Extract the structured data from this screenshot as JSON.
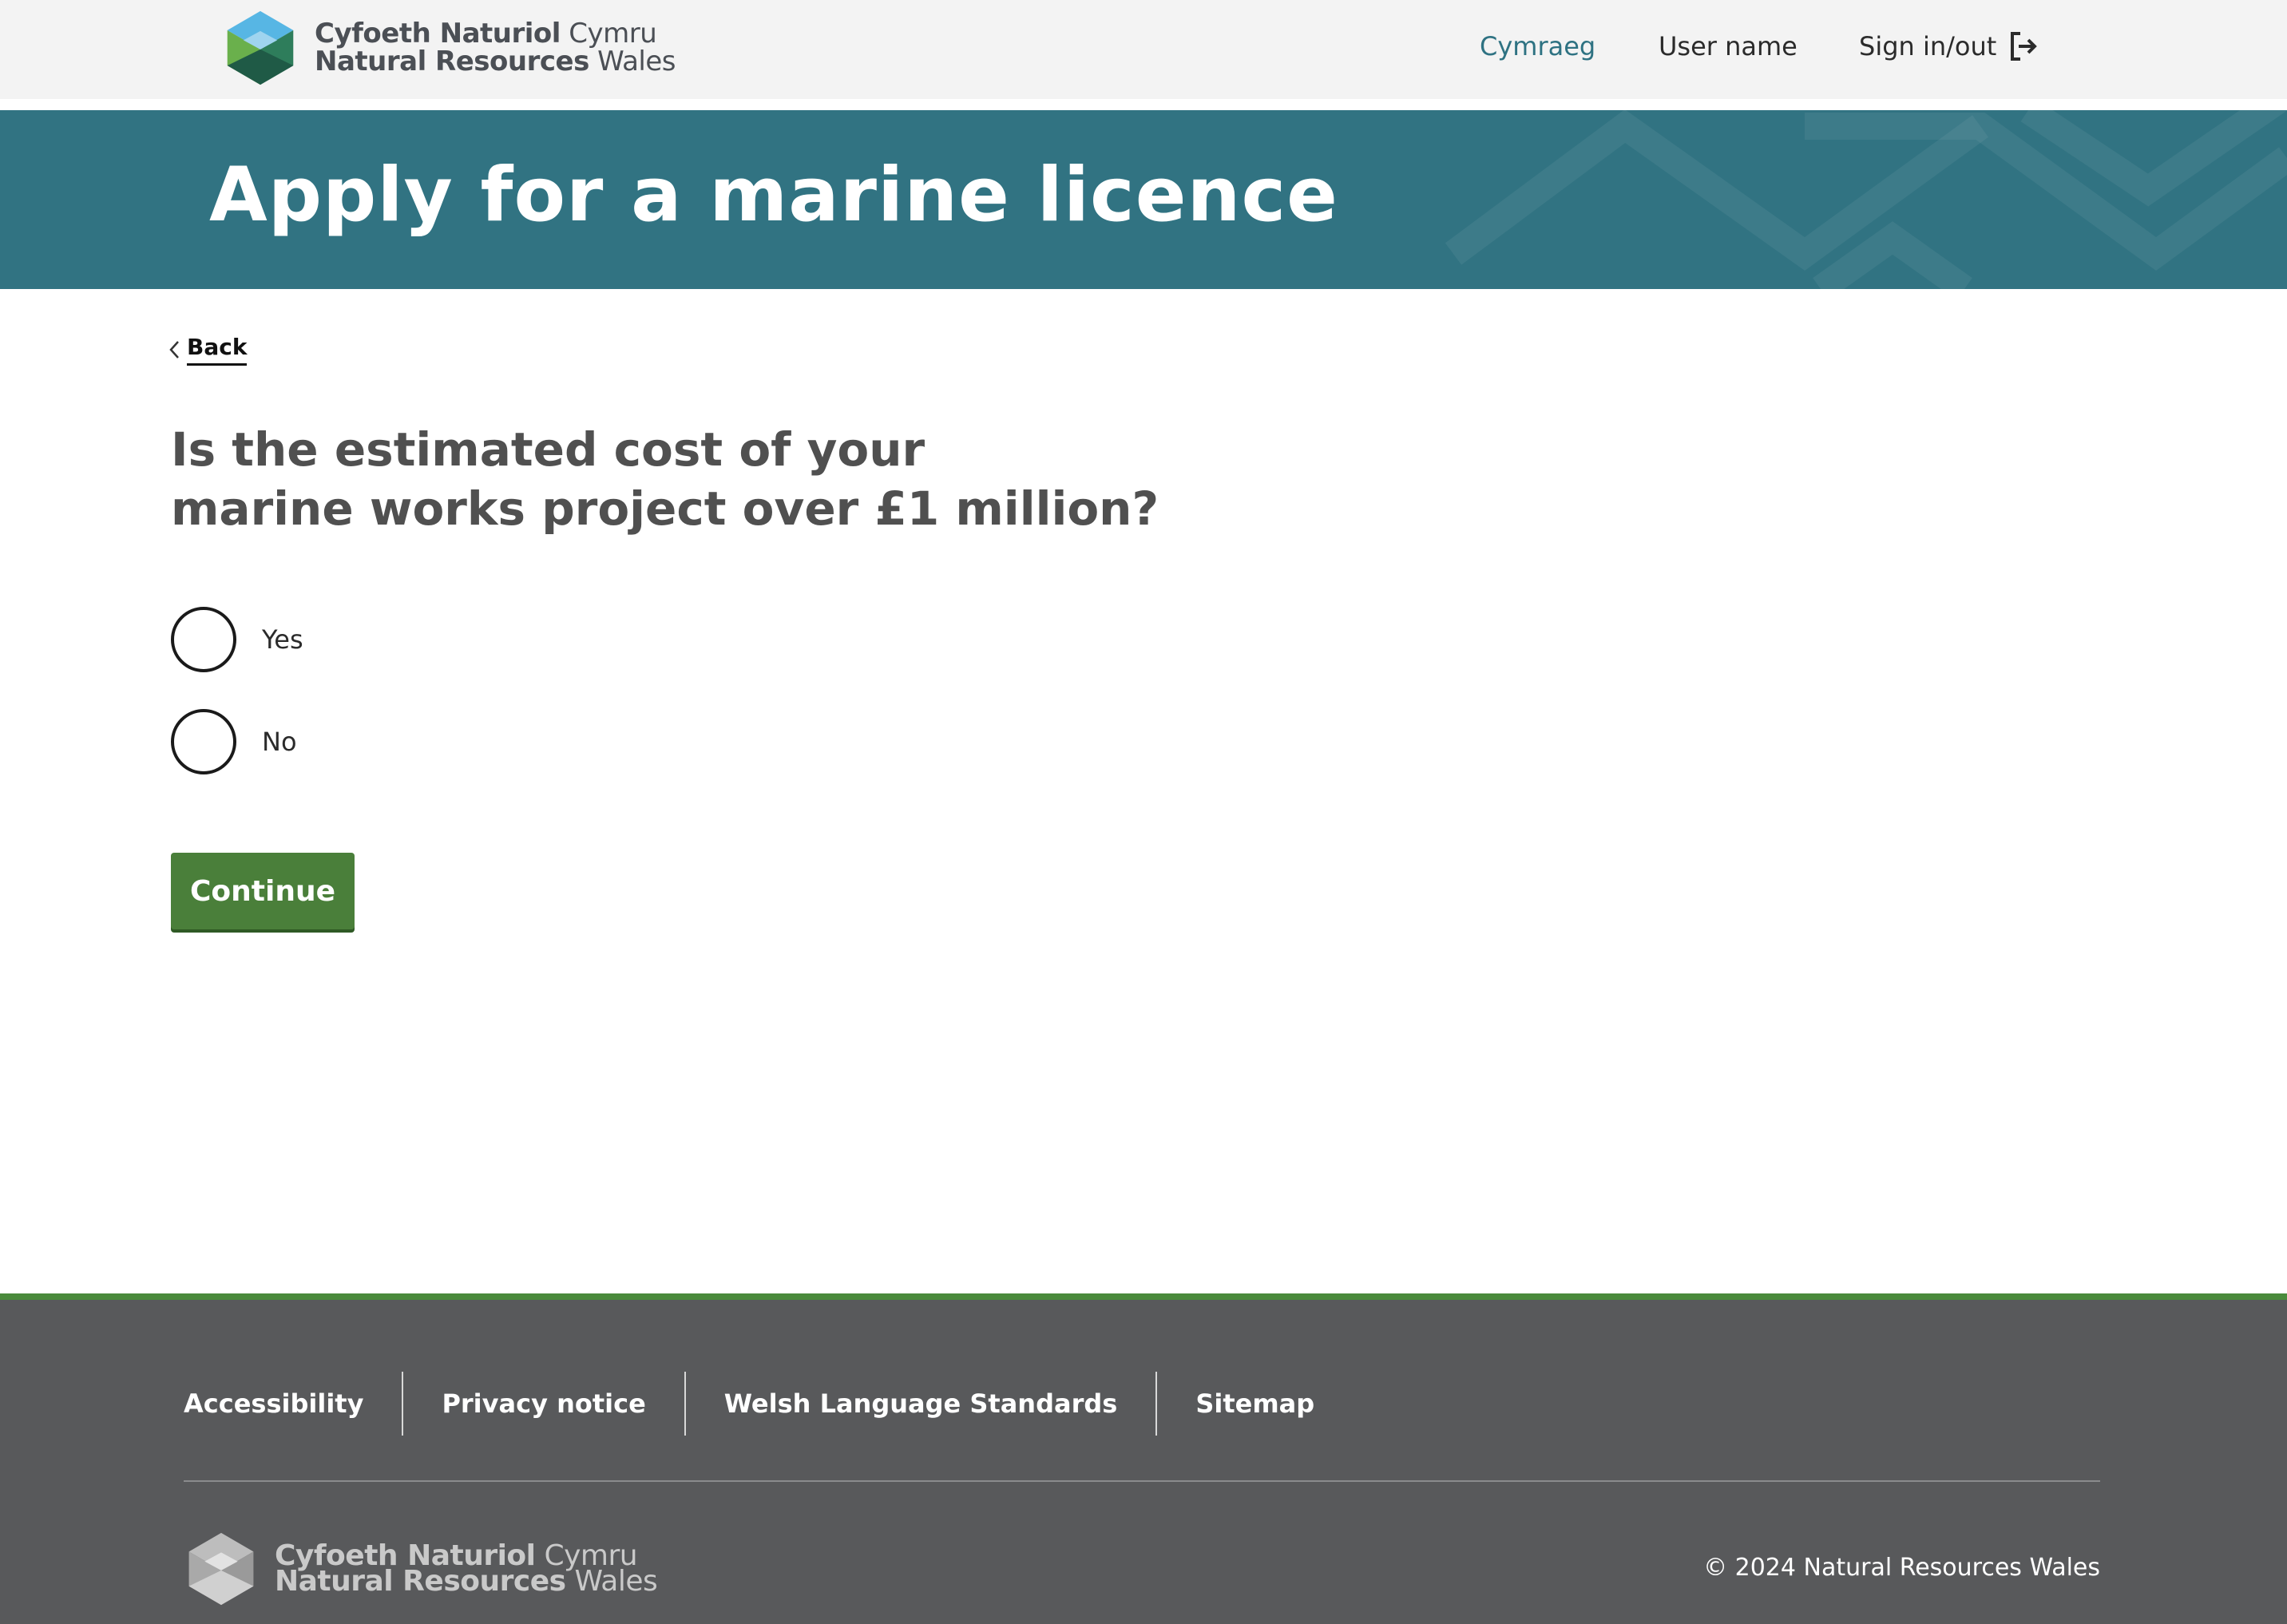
{
  "header": {
    "brand": {
      "welsh_bold": "Cyfoeth Naturiol",
      "welsh_light": "Cymru",
      "english_bold": "Natural Resources",
      "english_light": "Wales"
    },
    "nav": {
      "language": "Cymraeg",
      "user": "User name",
      "sign": "Sign in/out"
    }
  },
  "banner": {
    "title": "Apply for a marine licence"
  },
  "main": {
    "back": "Back",
    "question_line1": "Is the estimated cost of your",
    "question_line2": "marine works project over £1 million?",
    "options": [
      {
        "label": "Yes",
        "selected": false
      },
      {
        "label": "No",
        "selected": false
      }
    ],
    "continue": "Continue"
  },
  "footer": {
    "links": [
      "Accessibility",
      "Privacy notice",
      "Welsh Language Standards",
      "Sitemap"
    ],
    "brand": {
      "welsh_bold": "Cyfoeth Naturiol",
      "welsh_light": "Cymru",
      "english_bold": "Natural Resources",
      "english_light": "Wales"
    },
    "copyright": "© 2024 Natural Resources Wales"
  },
  "colors": {
    "banner": "#317382",
    "button": "#4a7f3a",
    "footer": "#58595b",
    "footer_accent": "#4a8a3c",
    "link": "#2e7282"
  }
}
